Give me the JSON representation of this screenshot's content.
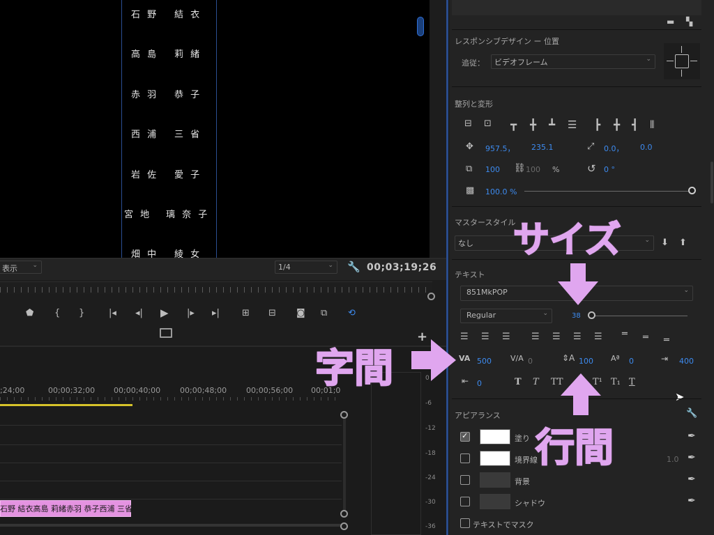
{
  "monitor": {
    "names_left": [
      "石 野",
      "高 島",
      "赤 羽",
      "西 浦",
      "岩 佐",
      "宮 地",
      "畑 中"
    ],
    "names_right": [
      "結 衣",
      "莉 緒",
      "恭 子",
      "三 省",
      "愛 子",
      "璃 奈 子",
      "綾 女"
    ],
    "display_mode": "表示",
    "resolution": "1/4",
    "timecode": "00;03;19;26"
  },
  "timeline": {
    "timecodes": [
      ";24;00",
      "00;00;32;00",
      "00;00;40;00",
      "00;00;48;00",
      "00;00;56;00",
      "00;01;0"
    ],
    "clip_label": "石野 結衣高島 莉緒赤羽 恭子西浦 三省",
    "meter_labels": [
      "0",
      "-6",
      "-12",
      "-18",
      "-24",
      "-30",
      "-36"
    ]
  },
  "panel": {
    "responsive": {
      "title": "レスポンシブデザイン ー 位置",
      "follow_label": "追従：",
      "follow_value": "ビデオフレーム"
    },
    "align": {
      "title": "整列と変形",
      "position_x": "957.5，",
      "position_y": "235.1",
      "anchor_x": "0.0，",
      "anchor_y": "0.0",
      "scale": "100",
      "scale_link": "100",
      "scale_unit": "%",
      "rotation": "0 °",
      "opacity": "100.0 %"
    },
    "master_style": {
      "title": "マスタースタイル",
      "value": "なし"
    },
    "text": {
      "title": "テキスト",
      "font": "851MkPOP",
      "style": "Regular",
      "size": "38",
      "tracking": "500",
      "kerning": "0",
      "leading": "100",
      "baseline": "0",
      "tab_width": "400",
      "tsume": "0"
    },
    "appearance": {
      "title": "アピアランス",
      "fill_label": "塗り",
      "stroke_label": "境界線",
      "stroke_width": "1.0",
      "background_label": "背景",
      "shadow_label": "シャドウ",
      "mask_label": "テキストでマスク"
    }
  },
  "annotations": {
    "size": "サイズ",
    "tracking": "字間",
    "leading": "行間"
  },
  "colors": {
    "accent": "#3d8bf0",
    "annotation": "#e0a6ef",
    "clip": "#e493e1",
    "work_area": "#d6c32a"
  }
}
